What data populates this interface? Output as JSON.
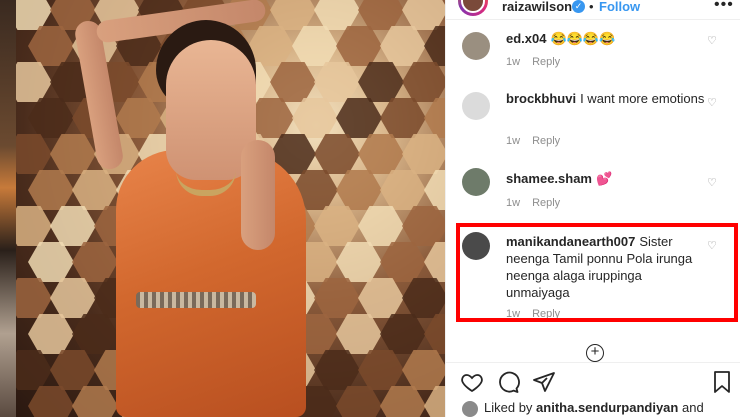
{
  "post": {
    "username": "raizawilson",
    "verified_badge": "✓",
    "separator": "•",
    "follow_label": "Follow",
    "more_label": "•••"
  },
  "comments": [
    {
      "username": "ed.x04",
      "text": "😂😂😂😂",
      "age": "1w",
      "reply_label": "Reply",
      "avatar_color": "#9a8f80"
    },
    {
      "username": "brockbhuvi",
      "text": "I want more emotions",
      "age": "1w",
      "reply_label": "Reply",
      "avatar_color": "#dbdbdb"
    },
    {
      "username": "shamee.sham",
      "text": "💕",
      "age": "1w",
      "reply_label": "Reply",
      "avatar_color": "#6e7b6a"
    },
    {
      "username": "manikandanearth007",
      "text": "Sister neenga Tamil ponnu Pola irunga neenga alaga iruppinga unmaiyaga",
      "age": "1w",
      "reply_label": "Reply",
      "avatar_color": "#4a4a4a"
    }
  ],
  "footer": {
    "load_more_symbol": "+",
    "liked_by_prefix": "Liked by",
    "liked_by_user": "anitha.sendurpandiyan",
    "liked_by_suffix": "and"
  },
  "colors": {
    "link_blue": "#3897f0",
    "highlight_red": "#ff0000",
    "meta_gray": "#8e8e8e"
  },
  "icons": [
    "heart-icon",
    "comment-icon",
    "share-icon",
    "bookmark-icon",
    "add-circle-icon",
    "verified-icon",
    "more-options-icon"
  ]
}
